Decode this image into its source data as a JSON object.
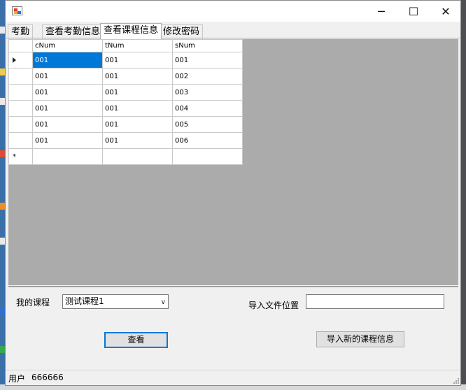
{
  "window": {
    "title": "",
    "controls": {
      "minimize": "─",
      "maximize": "☐",
      "close": "✕"
    }
  },
  "tabs": [
    {
      "label": "考勤",
      "active": false
    },
    {
      "label": "查看考勤信息",
      "active": false
    },
    {
      "label": "查看课程信息",
      "active": true
    },
    {
      "label": "修改密码",
      "active": false
    }
  ],
  "grid": {
    "columns": [
      "cNum",
      "tNum",
      "sNum"
    ],
    "rows": [
      [
        "001",
        "001",
        "001"
      ],
      [
        "001",
        "001",
        "002"
      ],
      [
        "001",
        "001",
        "003"
      ],
      [
        "001",
        "001",
        "004"
      ],
      [
        "001",
        "001",
        "005"
      ],
      [
        "001",
        "001",
        "006"
      ]
    ],
    "new_row_marker": "*"
  },
  "form": {
    "my_course_label": "我的课程",
    "course_select_value": "测试课程1",
    "import_location_label": "导入文件位置",
    "import_location_value": "",
    "view_button": "查看",
    "import_button": "导入新的课程信息"
  },
  "status": {
    "user_label": "用户",
    "user_value": "666666"
  },
  "colors": {
    "selection": "#0078d7",
    "grid_background": "#ababab",
    "window_background": "#f0f0f0"
  }
}
